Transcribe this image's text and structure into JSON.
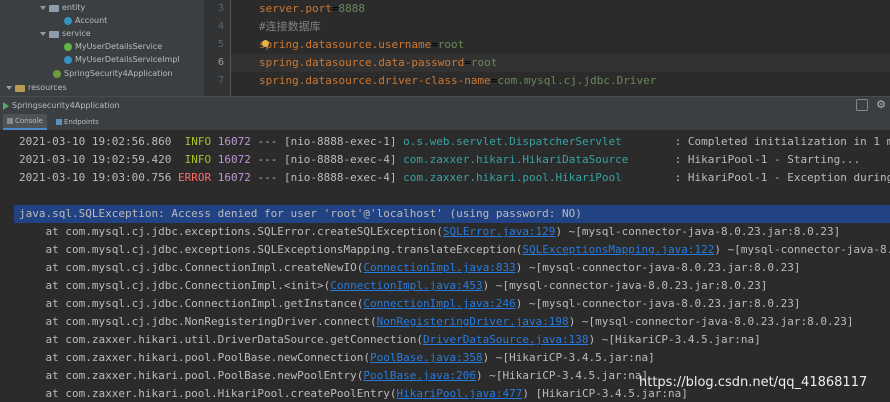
{
  "tree": {
    "items": [
      {
        "label": "entity",
        "type": "folder"
      },
      {
        "label": "Account",
        "type": "class"
      },
      {
        "label": "service",
        "type": "folder"
      },
      {
        "label": "MyUserDetailsService",
        "type": "interface"
      },
      {
        "label": "MyUserDetailsServiceImpl",
        "type": "class"
      },
      {
        "label": "SpringSecurity4Application",
        "type": "spring"
      },
      {
        "label": "resources",
        "type": "folder"
      }
    ]
  },
  "editor": {
    "line_numbers": [
      "3",
      "4",
      "5",
      "6",
      "7"
    ],
    "lines": [
      {
        "key": "server.port",
        "value": "8888"
      },
      {
        "comment": "#连接数据库"
      },
      {
        "key": "spring.datasource.username",
        "value": "root"
      },
      {
        "key": "spring.datasource.data-password",
        "value": "root"
      },
      {
        "key": "spring.datasource.driver-class-name",
        "value": "com.mysql.cj.jdbc.Driver"
      }
    ]
  },
  "run": {
    "tab_label": "Springsecurity4Application",
    "subtabs": [
      "Console",
      "Endpoints"
    ]
  },
  "console": {
    "logs": [
      {
        "ts": "2021-03-10 19:02:56.860",
        "level": "INFO",
        "pid": "16072",
        "thread": "--- [nio-8888-exec-1]",
        "logger": "o.s.web.servlet.DispatcherServlet",
        "msg": "        : Completed initialization in 1 ms"
      },
      {
        "ts": "2021-03-10 19:02:59.420",
        "level": "INFO",
        "pid": "16072",
        "thread": "--- [nio-8888-exec-4]",
        "logger": "com.zaxxer.hikari.HikariDataSource",
        "msg": "       : HikariPool-1 - Starting..."
      },
      {
        "ts": "2021-03-10 19:03:00.756",
        "level": "ERROR",
        "pid": "16072",
        "thread": "--- [nio-8888-exec-4]",
        "logger": "com.zaxxer.hikari.pool.HikariPool",
        "msg": "        : HikariPool-1 - Exception during p"
      }
    ],
    "exception": "java.sql.SQLException: Access denied for user 'root'@'localhost' (using password: NO)",
    "stack": [
      {
        "pre": "    at com.mysql.cj.jdbc.exceptions.SQLError.createSQLException(",
        "link": "SQLError.java:129",
        "post": ") ~[mysql-connector-java-8.0.23.jar:8.0.23]"
      },
      {
        "pre": "    at com.mysql.cj.jdbc.exceptions.SQLExceptionsMapping.translateException(",
        "link": "SQLExceptionsMapping.java:122",
        "post": ") ~[mysql-connector-java-8.0."
      },
      {
        "pre": "    at com.mysql.cj.jdbc.ConnectionImpl.createNewIO(",
        "link": "ConnectionImpl.java:833",
        "post": ") ~[mysql-connector-java-8.0.23.jar:8.0.23]"
      },
      {
        "pre": "    at com.mysql.cj.jdbc.ConnectionImpl.<init>(",
        "link": "ConnectionImpl.java:453",
        "post": ") ~[mysql-connector-java-8.0.23.jar:8.0.23]"
      },
      {
        "pre": "    at com.mysql.cj.jdbc.ConnectionImpl.getInstance(",
        "link": "ConnectionImpl.java:246",
        "post": ") ~[mysql-connector-java-8.0.23.jar:8.0.23]"
      },
      {
        "pre": "    at com.mysql.cj.jdbc.NonRegisteringDriver.connect(",
        "link": "NonRegisteringDriver.java:198",
        "post": ") ~[mysql-connector-java-8.0.23.jar:8.0.23]"
      },
      {
        "pre": "    at com.zaxxer.hikari.util.DriverDataSource.getConnection(",
        "link": "DriverDataSource.java:138",
        "post": ") ~[HikariCP-3.4.5.jar:na]"
      },
      {
        "pre": "    at com.zaxxer.hikari.pool.PoolBase.newConnection(",
        "link": "PoolBase.java:358",
        "post": ") ~[HikariCP-3.4.5.jar:na]"
      },
      {
        "pre": "    at com.zaxxer.hikari.pool.PoolBase.newPoolEntry(",
        "link": "PoolBase.java:206",
        "post": ") ~[HikariCP-3.4.5.jar:na]"
      },
      {
        "pre": "    at com.zaxxer.hikari.pool.HikariPool.createPoolEntry(",
        "link": "HikariPool.java:477",
        "post": ") [HikariCP-3.4.5.jar:na]"
      }
    ]
  },
  "watermark": "https://blog.csdn.net/qq_41868117",
  "colors": {
    "info": "#a8c023",
    "error": "#ff6b68",
    "selection": "#214283",
    "link": "#287bde"
  }
}
